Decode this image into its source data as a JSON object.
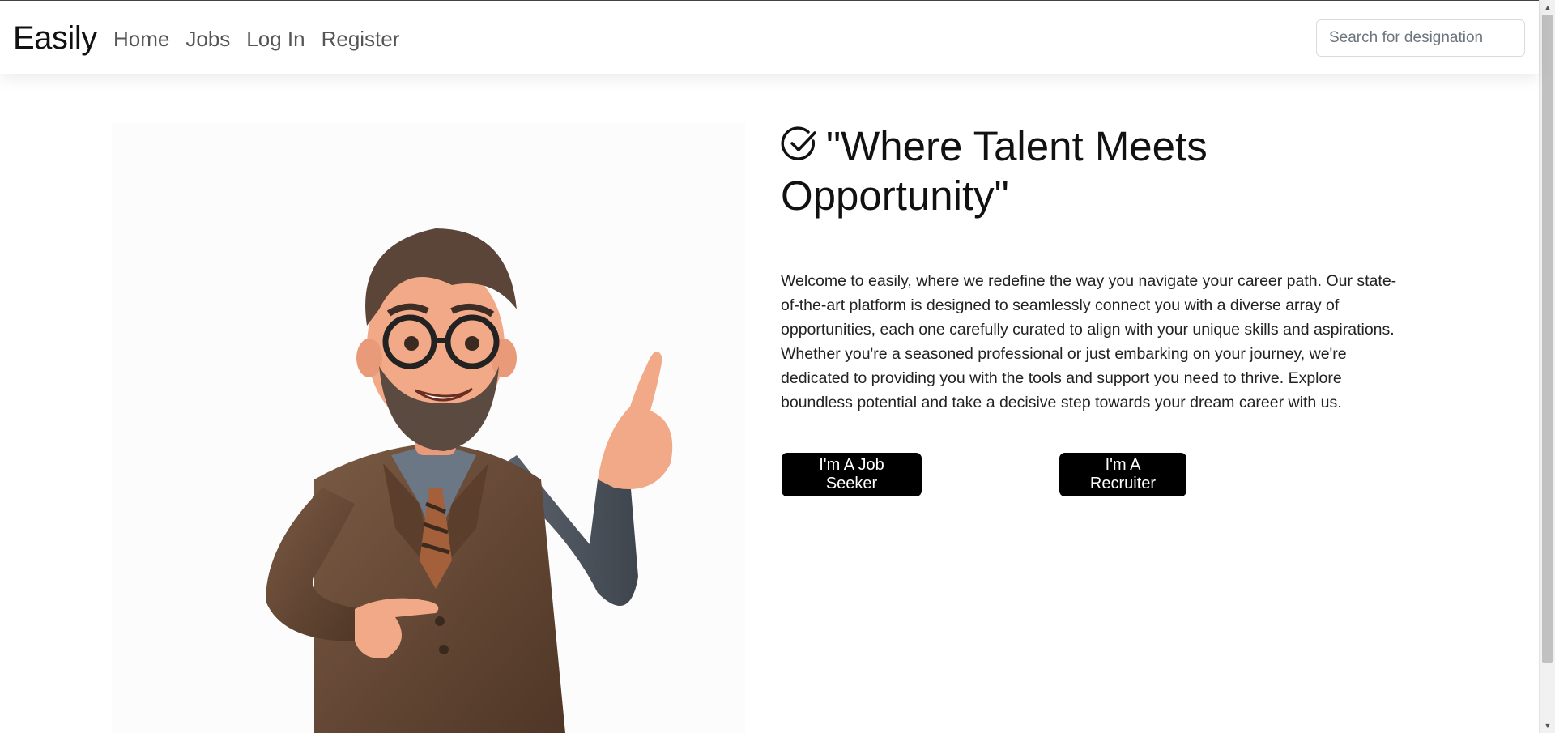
{
  "navbar": {
    "brand": "Easily",
    "links": [
      {
        "label": "Home"
      },
      {
        "label": "Jobs"
      },
      {
        "label": "Log In"
      },
      {
        "label": "Register"
      }
    ],
    "search": {
      "placeholder": "Search for designation",
      "value": ""
    }
  },
  "hero": {
    "headline": "\"Where Talent Meets Opportunity\"",
    "headline_icon": "check-circle-icon",
    "description": "Welcome to easily, where we redefine the way you navigate your career path. Our state-of-the-art platform is designed to seamlessly connect you with a diverse array of opportunities, each one carefully curated to align with your unique skills and aspirations. Whether you're a seasoned professional or just embarking on your journey, we're dedicated to providing you with the tools and support you need to thrive. Explore boundless potential and take a decisive step towards your dream career with us.",
    "buttons": {
      "job_seeker": "I'm A Job Seeker",
      "recruiter": "I'm A Recruiter"
    },
    "illustration": "cartoon-businessman-pointing"
  },
  "colors": {
    "button_bg": "#000000",
    "button_text": "#ffffff",
    "nav_link": "#555555",
    "brand": "#111111"
  }
}
